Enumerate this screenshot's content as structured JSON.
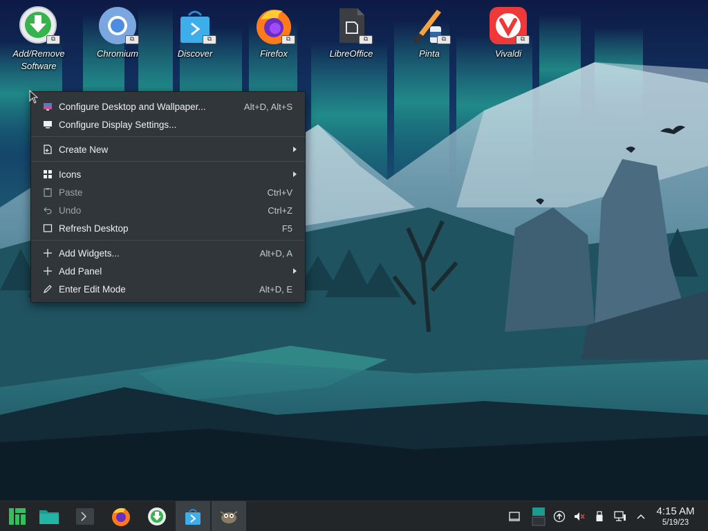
{
  "desktop": {
    "icons": [
      {
        "label": "Add/Remove Software",
        "line1": "Add/Remove",
        "line2": "Software"
      },
      {
        "label": "Chromium"
      },
      {
        "label": "Discover"
      },
      {
        "label": "Firefox"
      },
      {
        "label": "LibreOffice"
      },
      {
        "label": "Pinta"
      },
      {
        "label": "Vivaldi"
      }
    ],
    "badge_glyph": "⧉"
  },
  "context_menu": {
    "items": [
      {
        "label": "Configure Desktop and Wallpaper...",
        "shortcut": "Alt+D, Alt+S",
        "icon": "desktop-wallpaper-icon"
      },
      {
        "label": "Configure Display Settings...",
        "shortcut": "",
        "icon": "display-icon"
      },
      {
        "label": "Create New",
        "shortcut": "",
        "icon": "document-new-icon",
        "submenu": true
      },
      {
        "label": "Icons",
        "shortcut": "",
        "icon": "grid-icon",
        "submenu": true
      },
      {
        "label": "Paste",
        "shortcut": "Ctrl+V",
        "icon": "clipboard-icon",
        "disabled": true
      },
      {
        "label": "Undo",
        "shortcut": "Ctrl+Z",
        "icon": "undo-icon",
        "disabled": true
      },
      {
        "label": "Refresh Desktop",
        "shortcut": "F5",
        "icon": "refresh-icon"
      },
      {
        "label": "Add Widgets...",
        "shortcut": "Alt+D, A",
        "icon": "plus-icon"
      },
      {
        "label": "Add Panel",
        "shortcut": "",
        "icon": "plus-icon",
        "submenu": true
      },
      {
        "label": "Enter Edit Mode",
        "shortcut": "Alt+D, E",
        "icon": "pencil-icon"
      }
    ]
  },
  "taskbar": {
    "apps": [
      "manjaro-logo-icon",
      "file-manager-icon",
      "terminal-icon",
      "firefox-icon",
      "add-remove-software-icon",
      "discover-icon",
      "gimp-icon"
    ],
    "tray": [
      "show-desktop-icon",
      "pager-icon",
      "updates-icon",
      "volume-muted-icon",
      "usb-device-icon",
      "network-icon",
      "tray-expand-icon"
    ],
    "clock": {
      "time": "4:15 AM",
      "date": "5/19/23"
    }
  },
  "colors": {
    "menu_bg": "#31363b",
    "menu_text": "#eff0f1",
    "menu_disabled": "#9fa3a6",
    "taskbar_bg": "#232629",
    "aurora": "#2ee6a8"
  }
}
